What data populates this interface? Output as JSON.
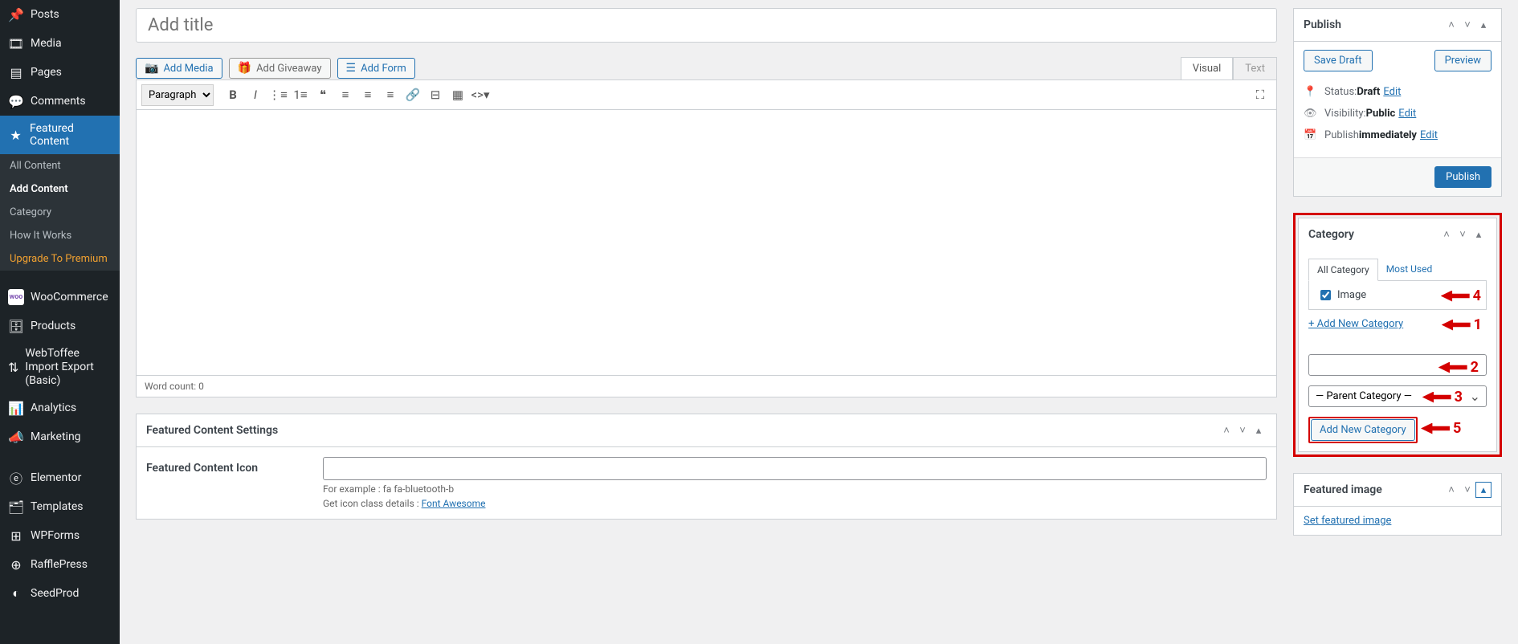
{
  "sidebar": {
    "items": [
      {
        "icon": "📌",
        "label": "Posts"
      },
      {
        "icon": "🖼",
        "label": "Media"
      },
      {
        "icon": "📄",
        "label": "Pages"
      },
      {
        "icon": "💬",
        "label": "Comments"
      },
      {
        "icon": "★",
        "label": "Featured Content",
        "active": true
      }
    ],
    "sub": [
      {
        "label": "All Content"
      },
      {
        "label": "Add Content",
        "bold": true
      },
      {
        "label": "Category"
      },
      {
        "label": "How It Works"
      },
      {
        "label": "Upgrade To Premium",
        "premium": true
      }
    ],
    "items2": [
      {
        "icon": "woo",
        "label": "WooCommerce"
      },
      {
        "icon": "📦",
        "label": "Products"
      },
      {
        "icon": "↕",
        "label": "WebToffee Import Export (Basic)"
      },
      {
        "icon": "📊",
        "label": "Analytics"
      },
      {
        "icon": "📢",
        "label": "Marketing"
      }
    ],
    "items3": [
      {
        "icon": "ⓔ",
        "label": "Elementor"
      },
      {
        "icon": "▤",
        "label": "Templates"
      },
      {
        "icon": "⊞",
        "label": "WPForms"
      },
      {
        "icon": "⊕",
        "label": "RafflePress"
      },
      {
        "icon": "◐",
        "label": "SeedProd"
      }
    ]
  },
  "editor": {
    "title_placeholder": "Add title",
    "add_media": "Add Media",
    "add_giveaway": "Add Giveaway",
    "add_form": "Add Form",
    "tab_visual": "Visual",
    "tab_text": "Text",
    "format_label": "Paragraph",
    "word_count": "Word count: 0"
  },
  "settings": {
    "title": "Featured Content Settings",
    "icon_label": "Featured Content Icon",
    "icon_help1": "For example : fa fa-bluetooth-b",
    "icon_help2": "Get icon class details : ",
    "icon_help_link": "Font Awesome"
  },
  "publish": {
    "title": "Publish",
    "save_draft": "Save Draft",
    "preview": "Preview",
    "status_label": "Status: ",
    "status_value": "Draft",
    "visibility_label": "Visibility: ",
    "visibility_value": "Public",
    "publish_label": "Publish ",
    "publish_value": "immediately",
    "edit": "Edit",
    "submit": "Publish"
  },
  "category": {
    "title": "Category",
    "tab_all": "All Category",
    "tab_most": "Most Used",
    "item_image": "Image",
    "add_new_link": "+ Add New Category",
    "parent_placeholder": "— Parent Category —",
    "add_new_btn": "Add New Category"
  },
  "featured_image": {
    "title": "Featured image",
    "set_link": "Set featured image"
  },
  "annotations": {
    "n1": "1",
    "n2": "2",
    "n3": "3",
    "n4": "4",
    "n5": "5"
  }
}
